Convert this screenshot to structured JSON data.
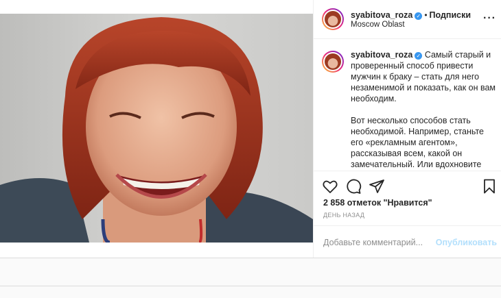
{
  "post": {
    "author": {
      "handle": "syabitova_roza",
      "verified": true,
      "follow_label": "Подписки",
      "location": "Moscow Oblast"
    },
    "photo": {
      "description_icon": "portrait-photo"
    },
    "caption": {
      "handle": "syabitova_roza",
      "paragraph_1": "Самый старый и проверенный способ привести мужчин к браку – стать для него незаменимой и показать, как он вам необходим.",
      "paragraph_2": "Вот несколько способов стать необходимой. Например, станьте его «рекламным агентом», рассказывая всем, какой он замечательный. Или вдохновите мужчину на то, чтобы он"
    },
    "likes_text": "2 858 отметок \"Нравится\"",
    "time_text": "ДЕНЬ НАЗАД",
    "comment": {
      "placeholder": "Добавьте комментарий...",
      "publish_label": "Опубликовать"
    },
    "icons": [
      "more-options-icon",
      "heart-icon",
      "comment-icon",
      "share-icon",
      "bookmark-icon",
      "verified-badge-icon"
    ],
    "colors": {
      "accent": "#3897f0",
      "publish_disabled": "#b2dffc",
      "muted": "#8e8e8e"
    }
  }
}
